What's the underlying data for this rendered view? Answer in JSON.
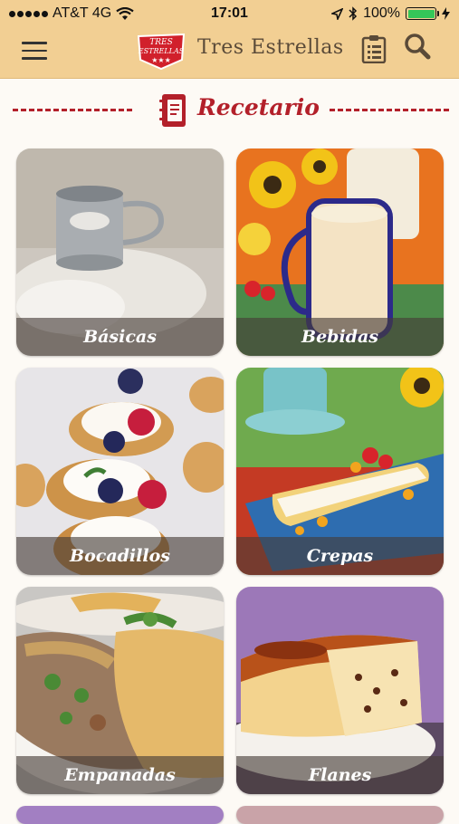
{
  "status_bar": {
    "carrier": "AT&T 4G",
    "time": "17:01",
    "battery": "100%",
    "icons": [
      "wifi-icon",
      "location-icon",
      "bluetooth-icon",
      "battery-icon",
      "charging-icon"
    ]
  },
  "navbar": {
    "logo_text_line1": "TRES",
    "logo_text_line2": "ESTRELLAS",
    "title": "Tres Estrellas",
    "icons": [
      "hamburger-menu-icon",
      "clipboard-list-icon",
      "search-icon"
    ]
  },
  "page": {
    "title": "Recetario",
    "icon": "recipe-book-icon"
  },
  "categories": [
    {
      "label": "Básicas"
    },
    {
      "label": "Bebidas"
    },
    {
      "label": "Bocadillos"
    },
    {
      "label": "Crepas"
    },
    {
      "label": "Empanadas"
    },
    {
      "label": "Flanes"
    }
  ],
  "colors": {
    "header_bg": "#f2cf93",
    "accent_red": "#b3202a",
    "page_bg": "#fdfaf5",
    "battery_green": "#35c759"
  }
}
